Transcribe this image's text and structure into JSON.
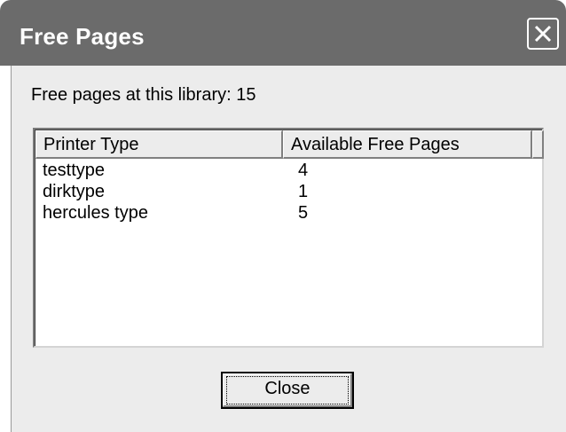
{
  "window": {
    "title": "Free Pages",
    "close_icon": "close-x-icon"
  },
  "summary": {
    "text": "Free pages at this library: 15"
  },
  "table": {
    "columns": [
      "Printer Type",
      "Available Free Pages"
    ],
    "rows": [
      {
        "printer_type": "testtype",
        "free_pages": "4"
      },
      {
        "printer_type": "dirktype",
        "free_pages": "1"
      },
      {
        "printer_type": "hercules type",
        "free_pages": "5"
      }
    ]
  },
  "buttons": {
    "close_label": "Close"
  },
  "colors": {
    "titlebar": "#6b6b6b",
    "dialog_face": "#ececec",
    "list_background": "#ffffff"
  }
}
